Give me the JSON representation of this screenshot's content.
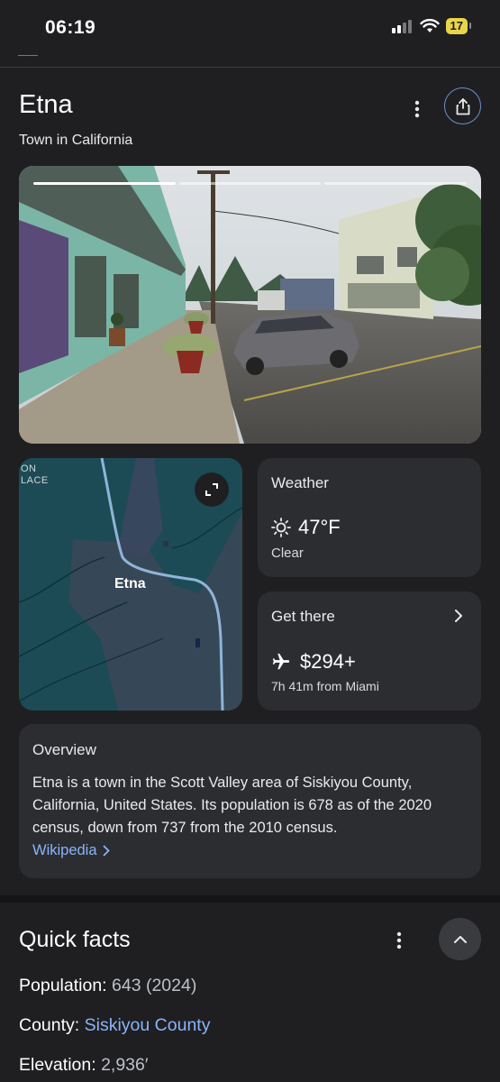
{
  "status": {
    "time": "06:19",
    "battery": "17"
  },
  "header": {
    "title": "Etna",
    "subtitle": "Town in California"
  },
  "icons": {
    "more": "more-vert-icon",
    "share": "share-icon",
    "expand": "expand-icon",
    "sun": "sun-icon",
    "plane": "airplane-icon",
    "chevron": "chevron-right-icon"
  },
  "photo": {
    "slides": 3,
    "active": 1
  },
  "map": {
    "place_label": "Etna",
    "corner_label": "ON\nLACE"
  },
  "weather": {
    "title": "Weather",
    "temp": "47°F",
    "condition": "Clear"
  },
  "get_there": {
    "title": "Get there",
    "price": "$294+",
    "route": "7h 41m from Miami"
  },
  "overview": {
    "title": "Overview",
    "text": "Etna is a town in the Scott Valley area of Siskiyou County, California, United States. Its population is 678 as of the 2020 census, down from 737 from the 2010 census.",
    "source": "Wikipedia"
  },
  "quick_facts": {
    "title": "Quick facts",
    "facts": [
      {
        "label": "Population",
        "value": "643 (2024)"
      },
      {
        "label": "County",
        "value": "Siskiyou County"
      },
      {
        "label": "Elevation",
        "value": "2,936′"
      }
    ]
  },
  "colors": {
    "bg": "#1f1f22",
    "card": "#2c2d31",
    "link": "#8ab4f8",
    "battery": "#e9d54a"
  }
}
